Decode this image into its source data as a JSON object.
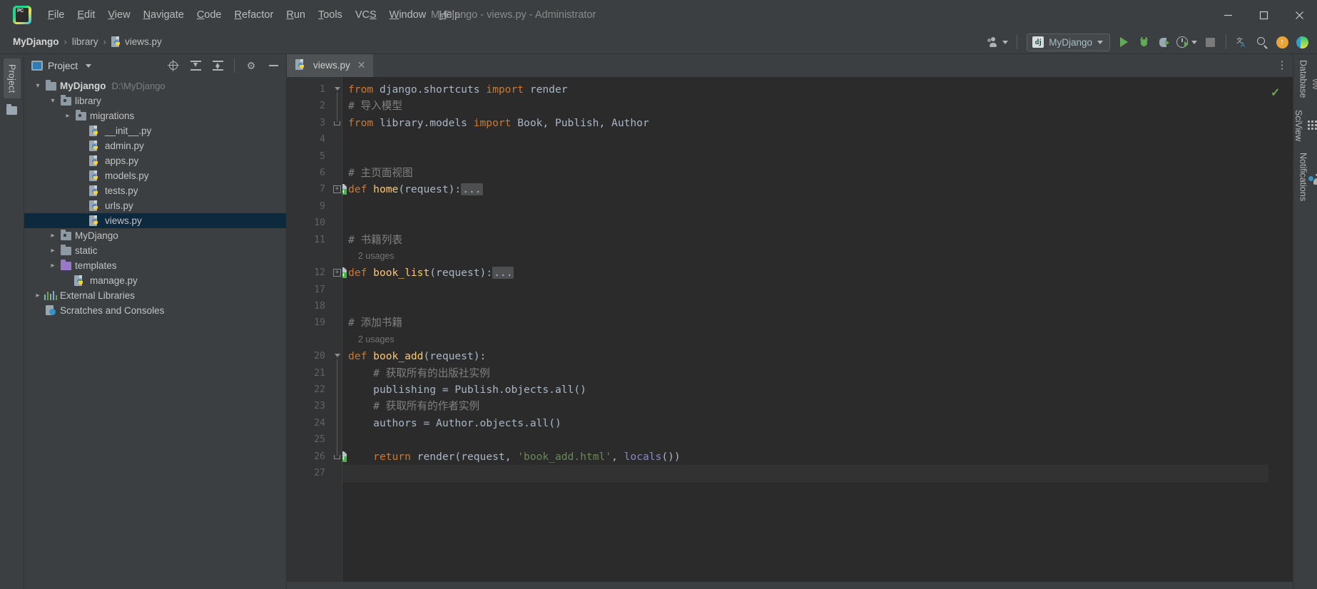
{
  "window": {
    "title": "MyDjango - views.py - Administrator",
    "app_icon": "pycharm-logo-icon",
    "controls": [
      {
        "name": "minimize-button",
        "glyph": "—"
      },
      {
        "name": "maximize-button",
        "glyph": "☐"
      },
      {
        "name": "close-button",
        "glyph": "✕"
      }
    ]
  },
  "menubar": {
    "items": [
      {
        "label": "File",
        "mnemonic": "F",
        "rest": "ile"
      },
      {
        "label": "Edit",
        "mnemonic": "E",
        "rest": "dit"
      },
      {
        "label": "View",
        "mnemonic": "V",
        "rest": "iew"
      },
      {
        "label": "Navigate",
        "mnemonic": "N",
        "rest": "avigate"
      },
      {
        "label": "Code",
        "mnemonic": "C",
        "rest": "ode"
      },
      {
        "label": "Refactor",
        "mnemonic": "R",
        "rest": "efactor"
      },
      {
        "label": "Run",
        "mnemonic": "R",
        "rest": "un",
        "pre": "R",
        "mid": "u",
        "post": "n"
      },
      {
        "label": "Tools",
        "mnemonic": "T",
        "rest": "ools"
      },
      {
        "label": "VCS",
        "mnemonic": "S",
        "rest": "",
        "pre": "VC",
        "post": ""
      },
      {
        "label": "Window",
        "mnemonic": "W",
        "rest": "indow"
      },
      {
        "label": "Help",
        "mnemonic": "H",
        "rest": "elp"
      }
    ]
  },
  "breadcrumb": {
    "project": "MyDjango",
    "sep": "›",
    "folder": "library",
    "file": "views.py"
  },
  "toolbar": {
    "share_label": "",
    "run_config_name": "MyDjango",
    "run_config_icon": "dj",
    "buttons": [
      {
        "name": "run-button",
        "title": "Run"
      },
      {
        "name": "debug-button",
        "title": "Debug"
      },
      {
        "name": "run-coverage-button",
        "title": "Run with Coverage"
      },
      {
        "name": "profile-button",
        "title": "Profile"
      },
      {
        "name": "stop-button",
        "title": "Stop"
      },
      {
        "name": "translate-button",
        "title": "Translate"
      },
      {
        "name": "search-everywhere-button",
        "title": "Search Everywhere"
      },
      {
        "name": "update-button",
        "title": "Update"
      },
      {
        "name": "jetbrains-toolbox-button",
        "title": "Toolbox"
      }
    ]
  },
  "left_stripe": {
    "project_label": "Project",
    "folder_icon": "folder-icon"
  },
  "project_panel": {
    "header": {
      "title": "Project",
      "view_icon": "project-view-icon",
      "actions": [
        {
          "name": "select-opened-file-button",
          "icon": "target-icon"
        },
        {
          "name": "expand-all-button",
          "icon": "expand-all-icon"
        },
        {
          "name": "collapse-all-button",
          "icon": "collapse-all-icon"
        },
        {
          "name": "settings-button",
          "icon": "gear-icon"
        },
        {
          "name": "hide-panel-button",
          "icon": "minus-icon"
        }
      ]
    },
    "tree": [
      {
        "label": "MyDjango",
        "path": "D:\\MyDjango",
        "indent": 0,
        "arrow": "down",
        "icon": "folder-root",
        "bold": true,
        "selected": false
      },
      {
        "label": "library",
        "path": "",
        "indent": 1,
        "arrow": "down",
        "icon": "folder-module",
        "bold": false,
        "selected": false
      },
      {
        "label": "migrations",
        "path": "",
        "indent": 2,
        "arrow": "right",
        "icon": "folder-module",
        "bold": false,
        "selected": false
      },
      {
        "label": "__init__.py",
        "path": "",
        "indent": 3,
        "arrow": "none",
        "icon": "python-file",
        "bold": false,
        "selected": false
      },
      {
        "label": "admin.py",
        "path": "",
        "indent": 3,
        "arrow": "none",
        "icon": "python-file",
        "bold": false,
        "selected": false
      },
      {
        "label": "apps.py",
        "path": "",
        "indent": 3,
        "arrow": "none",
        "icon": "python-file",
        "bold": false,
        "selected": false
      },
      {
        "label": "models.py",
        "path": "",
        "indent": 3,
        "arrow": "none",
        "icon": "python-file",
        "bold": false,
        "selected": false
      },
      {
        "label": "tests.py",
        "path": "",
        "indent": 3,
        "arrow": "none",
        "icon": "python-file",
        "bold": false,
        "selected": false
      },
      {
        "label": "urls.py",
        "path": "",
        "indent": 3,
        "arrow": "none",
        "icon": "python-file",
        "bold": false,
        "selected": false
      },
      {
        "label": "views.py",
        "path": "",
        "indent": 3,
        "arrow": "none",
        "icon": "python-file",
        "bold": false,
        "selected": true
      },
      {
        "label": "MyDjango",
        "path": "",
        "indent": 1,
        "arrow": "right",
        "icon": "folder-module",
        "bold": false,
        "selected": false
      },
      {
        "label": "static",
        "path": "",
        "indent": 1,
        "arrow": "right",
        "icon": "folder-plain",
        "bold": false,
        "selected": false
      },
      {
        "label": "templates",
        "path": "",
        "indent": 1,
        "arrow": "right",
        "icon": "folder-templates",
        "bold": false,
        "selected": false
      },
      {
        "label": "manage.py",
        "path": "",
        "indent": 2,
        "arrow": "none",
        "icon": "python-file",
        "bold": false,
        "selected": false
      },
      {
        "label": "External Libraries",
        "path": "",
        "indent": 0,
        "arrow": "right",
        "icon": "libraries",
        "bold": false,
        "selected": false
      },
      {
        "label": "Scratches and Consoles",
        "path": "",
        "indent": 0,
        "arrow": "none",
        "icon": "scratches",
        "bold": false,
        "selected": false
      }
    ]
  },
  "editor": {
    "tabs": [
      {
        "label": "views.py",
        "icon": "python-file",
        "active": true,
        "close": "✕"
      }
    ],
    "more_icon": "more-vertical-icon",
    "inspection_status": "ok-checkmark",
    "lines": [
      {
        "num": "1",
        "gutter": "",
        "fold": "fold-start",
        "indent": 0,
        "tokens": [
          {
            "t": "from ",
            "c": "kw"
          },
          {
            "t": "django.shortcuts ",
            "c": "id"
          },
          {
            "t": "import ",
            "c": "kw"
          },
          {
            "t": "render",
            "c": "id"
          }
        ]
      },
      {
        "num": "2",
        "gutter": "",
        "fold": "line",
        "indent": 0,
        "tokens": [
          {
            "t": "# 导入模型",
            "c": "cmt"
          }
        ]
      },
      {
        "num": "3",
        "gutter": "",
        "fold": "fold-end",
        "indent": 0,
        "tokens": [
          {
            "t": "from ",
            "c": "kw"
          },
          {
            "t": "library.models ",
            "c": "id"
          },
          {
            "t": "import ",
            "c": "kw"
          },
          {
            "t": "Book, Publish, Author",
            "c": "id"
          }
        ]
      },
      {
        "num": "4",
        "gutter": "",
        "fold": "",
        "indent": 0,
        "tokens": []
      },
      {
        "num": "5",
        "gutter": "",
        "fold": "",
        "indent": 0,
        "tokens": []
      },
      {
        "num": "6",
        "gutter": "",
        "fold": "",
        "indent": 0,
        "tokens": [
          {
            "t": "# 主页面视图",
            "c": "cmt"
          }
        ]
      },
      {
        "num": "7",
        "gutter": "html-run",
        "fold": "collapsed",
        "indent": 0,
        "tokens": [
          {
            "t": "def ",
            "c": "kw"
          },
          {
            "t": "home",
            "c": "fn"
          },
          {
            "t": "(",
            "c": "par"
          },
          {
            "t": "request",
            "c": "id"
          },
          {
            "t": "):",
            "c": "par"
          },
          {
            "t": "...",
            "c": "fold-dots"
          }
        ]
      },
      {
        "num": "9",
        "gutter": "",
        "fold": "",
        "indent": 0,
        "tokens": []
      },
      {
        "num": "10",
        "gutter": "",
        "fold": "",
        "indent": 0,
        "tokens": []
      },
      {
        "num": "11",
        "gutter": "",
        "fold": "",
        "indent": 0,
        "tokens": [
          {
            "t": "# 书籍列表",
            "c": "cmt"
          }
        ]
      },
      {
        "num": "",
        "gutter": "",
        "fold": "",
        "indent": 0,
        "usages": "2 usages",
        "tokens": []
      },
      {
        "num": "12",
        "gutter": "html-run",
        "fold": "collapsed",
        "indent": 0,
        "tokens": [
          {
            "t": "def ",
            "c": "kw"
          },
          {
            "t": "book_list",
            "c": "fn"
          },
          {
            "t": "(",
            "c": "par"
          },
          {
            "t": "request",
            "c": "id"
          },
          {
            "t": "):",
            "c": "par"
          },
          {
            "t": "...",
            "c": "fold-dots"
          }
        ]
      },
      {
        "num": "17",
        "gutter": "",
        "fold": "",
        "indent": 0,
        "tokens": []
      },
      {
        "num": "18",
        "gutter": "",
        "fold": "",
        "indent": 0,
        "tokens": []
      },
      {
        "num": "19",
        "gutter": "",
        "fold": "",
        "indent": 0,
        "tokens": [
          {
            "t": "# 添加书籍",
            "c": "cmt"
          }
        ]
      },
      {
        "num": "",
        "gutter": "",
        "fold": "",
        "indent": 0,
        "usages": "2 usages",
        "tokens": []
      },
      {
        "num": "20",
        "gutter": "",
        "fold": "fold-start",
        "indent": 0,
        "tokens": [
          {
            "t": "def ",
            "c": "kw"
          },
          {
            "t": "book_add",
            "c": "fn"
          },
          {
            "t": "(",
            "c": "par"
          },
          {
            "t": "request",
            "c": "id"
          },
          {
            "t": "):",
            "c": "par"
          }
        ]
      },
      {
        "num": "21",
        "gutter": "",
        "fold": "line",
        "indent": 1,
        "tokens": [
          {
            "t": "# 获取所有的出版社实例",
            "c": "cmt"
          }
        ]
      },
      {
        "num": "22",
        "gutter": "",
        "fold": "line",
        "indent": 1,
        "tokens": [
          {
            "t": "publishing ",
            "c": "id"
          },
          {
            "t": "= ",
            "c": "par"
          },
          {
            "t": "Publish.objects.",
            "c": "id"
          },
          {
            "t": "all",
            "c": "id"
          },
          {
            "t": "()",
            "c": "par"
          }
        ]
      },
      {
        "num": "23",
        "gutter": "",
        "fold": "line",
        "indent": 1,
        "tokens": [
          {
            "t": "# 获取所有的作者实例",
            "c": "cmt"
          }
        ]
      },
      {
        "num": "24",
        "gutter": "",
        "fold": "line",
        "indent": 1,
        "tokens": [
          {
            "t": "authors ",
            "c": "id"
          },
          {
            "t": "= ",
            "c": "par"
          },
          {
            "t": "Author.objects.",
            "c": "id"
          },
          {
            "t": "all",
            "c": "id"
          },
          {
            "t": "()",
            "c": "par"
          }
        ]
      },
      {
        "num": "25",
        "gutter": "",
        "fold": "line",
        "indent": 0,
        "tokens": []
      },
      {
        "num": "26",
        "gutter": "html-run",
        "fold": "fold-end",
        "indent": 1,
        "tokens": [
          {
            "t": "return ",
            "c": "kw"
          },
          {
            "t": "render",
            "c": "id"
          },
          {
            "t": "(",
            "c": "par"
          },
          {
            "t": "request, ",
            "c": "id"
          },
          {
            "t": "'book_add.html'",
            "c": "str"
          },
          {
            "t": ", ",
            "c": "par"
          },
          {
            "t": "locals",
            "c": "bi"
          },
          {
            "t": "())",
            "c": "par"
          }
        ]
      },
      {
        "num": "27",
        "gutter": "",
        "fold": "",
        "indent": 0,
        "tokens": []
      }
    ],
    "gutter_badge_text": "H"
  },
  "right_stripe": {
    "items": [
      {
        "label": "Database",
        "icon": "database-icon"
      },
      {
        "label": "SciView",
        "icon": "grid-icon"
      },
      {
        "label": "Notifications",
        "icon": "bell-icon",
        "badge": true
      }
    ]
  },
  "colors": {
    "accent_green": "#5fad52",
    "selection_blue": "#0d293e",
    "editor_bg": "#2b2b2b",
    "panel_bg": "#3c3f41",
    "gutter_bg": "#313335",
    "keyword": "#cc7832",
    "function": "#ffc66d",
    "string": "#6a8759",
    "comment": "#808080",
    "identifier": "#a9b7c6",
    "builtin": "#8888c6"
  }
}
